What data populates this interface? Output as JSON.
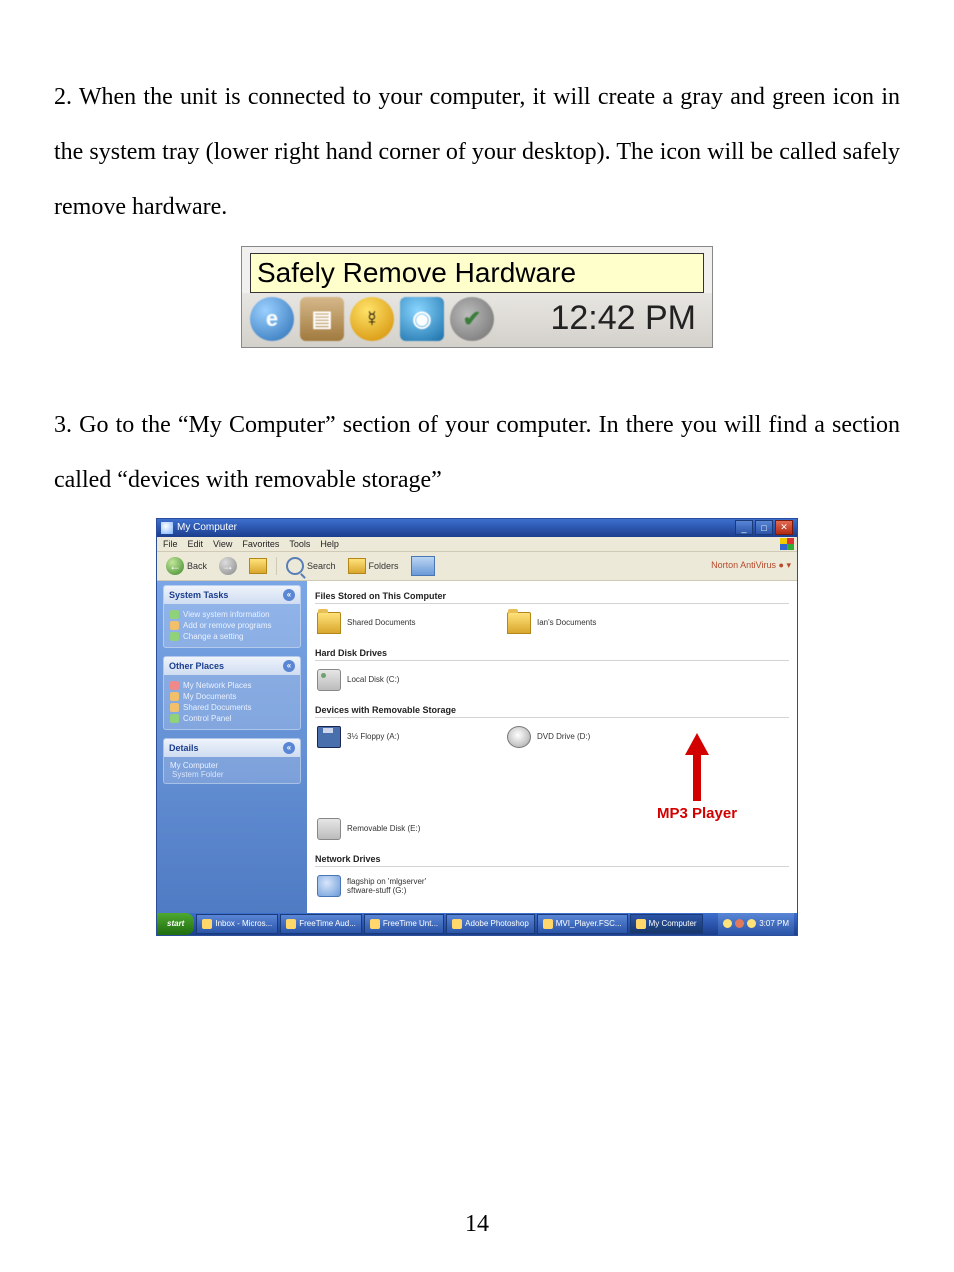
{
  "paragraphs": {
    "p1": "2. When the unit is connected to your computer, it will create a gray and green icon in the system tray (lower right hand corner of your desktop). The icon will be called safely remove hardware.",
    "p2": "3. Go to the “My Computer” section of your computer. In there you will find a section called “devices with removable storage”"
  },
  "page_number": "14",
  "fig1": {
    "tooltip": "Safely Remove Hardware",
    "time": "12:42 PM"
  },
  "fig2": {
    "title": "My Computer",
    "menus": {
      "file": "File",
      "edit": "Edit",
      "view": "View",
      "favorites": "Favorites",
      "tools": "Tools",
      "help": "Help"
    },
    "toolbar": {
      "back": "Back",
      "search": "Search",
      "folders": "Folders",
      "nav_right": "Norton AntiVirus"
    },
    "side": {
      "tasks_title": "System Tasks",
      "tasks": {
        "t1": "View system information",
        "t2": "Add or remove programs",
        "t3": "Change a setting"
      },
      "places_title": "Other Places",
      "places": {
        "p1": "My Network Places",
        "p2": "My Documents",
        "p3": "Shared Documents",
        "p4": "Control Panel"
      },
      "details_title": "Details",
      "details_label": "My Computer",
      "details_sub": "System Folder"
    },
    "sections": {
      "files_label": "Files Stored on This Computer",
      "files": {
        "shared": "Shared Documents",
        "user": "Ian's Documents"
      },
      "hdd_label": "Hard Disk Drives",
      "hdd": {
        "c": "Local Disk (C:)"
      },
      "rem_label": "Devices with Removable Storage",
      "rem": {
        "a": "3½ Floppy (A:)",
        "d": "DVD Drive (D:)",
        "e": "Removable Disk (E:)"
      },
      "net_label": "Network Drives",
      "net": {
        "n1": "flagship on 'mlgserver'\nsftware-stuff (G:)"
      }
    },
    "annotation": "MP3 Player",
    "taskbar": {
      "start": "start",
      "tasks": {
        "t1": "Inbox - Micros...",
        "t2": "FreeTime Aud...",
        "t3": "FreeTime Unt...",
        "t4": "Adobe Photoshop",
        "t5": "MVI_Player.FSC...",
        "t6": "My Computer"
      },
      "clock": "3:07 PM"
    }
  }
}
